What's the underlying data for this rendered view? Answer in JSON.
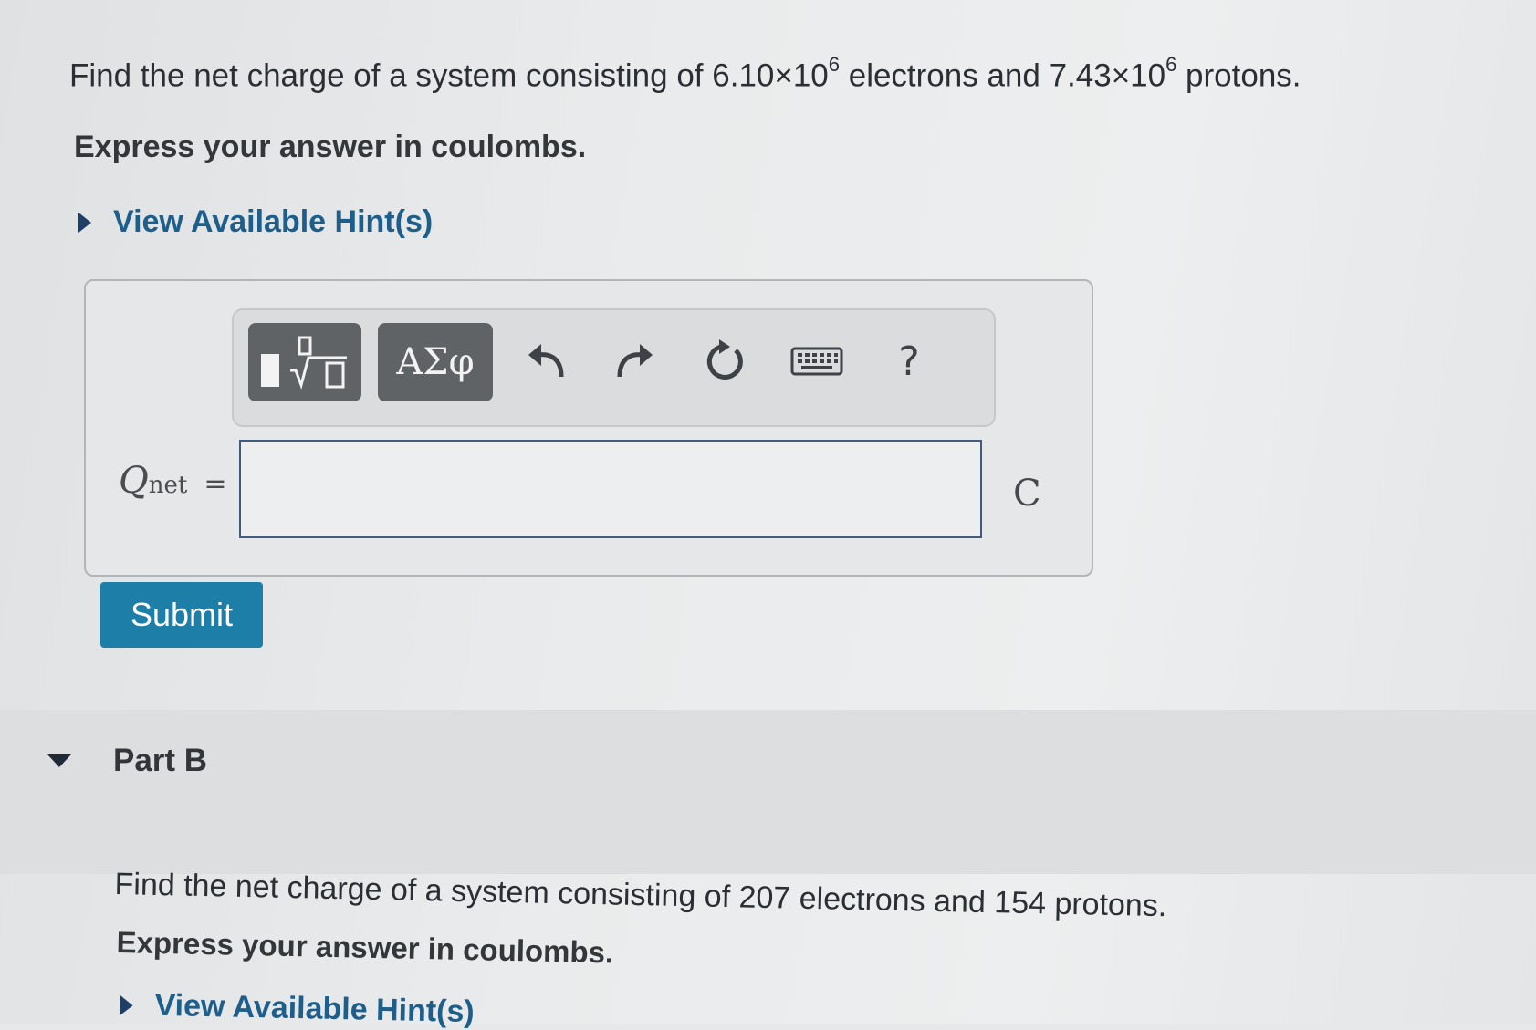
{
  "part_a": {
    "question_prefix": "Find the net charge of a system consisting of 6.10×10",
    "exp1": "6",
    "question_middle": " electrons and 7.43×10",
    "exp2": "6",
    "question_suffix": " protons.",
    "instruction": "Express your answer in coulombs.",
    "hint_label": "View Available Hint(s)",
    "toolbar": {
      "symbols_label": "ΑΣφ",
      "undo_glyph": "↶",
      "redo_glyph": "↷",
      "reset_glyph": "↻",
      "help_label": "?"
    },
    "variable_symbol": "Q",
    "variable_subscript": "net",
    "equals": "=",
    "answer_value": "",
    "unit": "C",
    "submit_label": "Submit"
  },
  "part_b": {
    "title": "Part B",
    "question": "Find the net charge of a system consisting of 207 electrons and 154 protons.",
    "instruction": "Express your answer in coulombs.",
    "hint_label": "View Available Hint(s)"
  },
  "colors": {
    "accent": "#1d7ea8",
    "link": "#1d5f8a",
    "toolbar_button": "#5f6366"
  }
}
